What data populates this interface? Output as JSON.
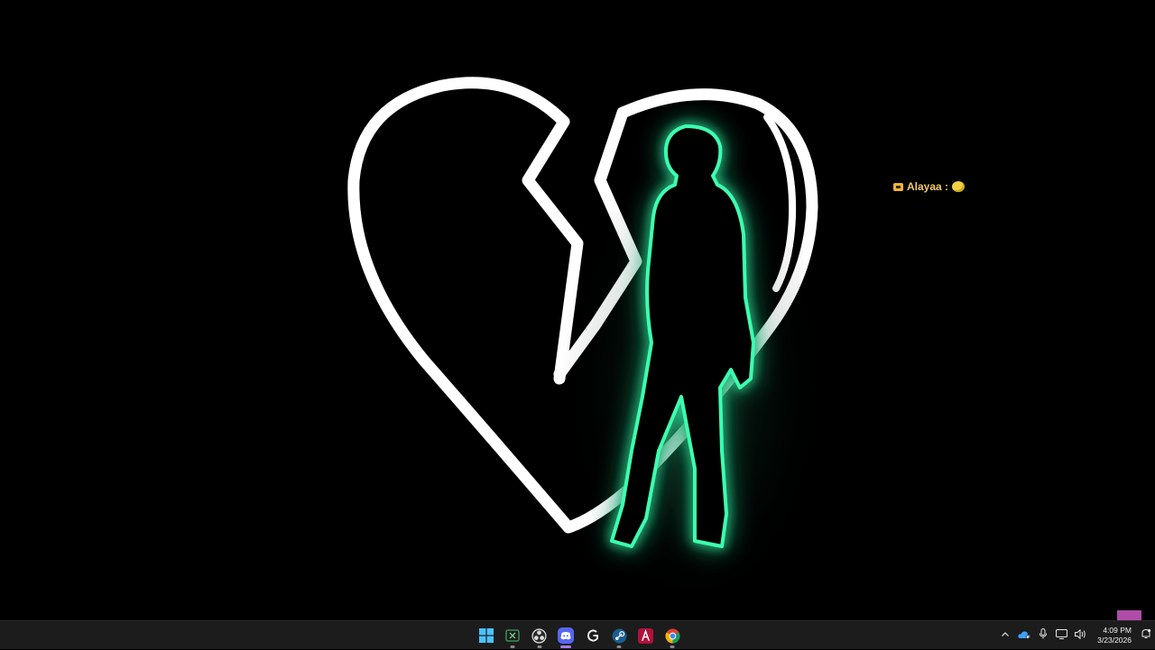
{
  "desktop": {
    "overlay_username": "Alayaa :",
    "colors": {
      "background": "#000000",
      "heart_outline": "#ffffff",
      "figure_glow": "#3dffb0",
      "overlay_text": "#f2c66a",
      "magenta_block": "#b04ca8"
    }
  },
  "taskbar": {
    "apps": [
      {
        "name": "start",
        "icon": "windows-start-icon",
        "running": false,
        "active": false
      },
      {
        "name": "xbox",
        "icon": "xbox-app-icon",
        "running": true,
        "active": false
      },
      {
        "name": "obs",
        "icon": "obs-studio-icon",
        "running": true,
        "active": false
      },
      {
        "name": "discord",
        "icon": "discord-icon",
        "running": true,
        "active": true
      },
      {
        "name": "g-app",
        "icon": "g-launcher-icon",
        "running": false,
        "active": false
      },
      {
        "name": "steam",
        "icon": "steam-icon",
        "running": true,
        "active": false
      },
      {
        "name": "aura",
        "icon": "red-a-app-icon",
        "running": false,
        "active": false
      },
      {
        "name": "chrome",
        "icon": "chrome-icon",
        "running": true,
        "active": false
      }
    ],
    "tray": {
      "icons": [
        "chevron-up-icon",
        "onedrive-icon",
        "microphone-icon",
        "display-network-icon",
        "volume-icon"
      ],
      "time": "4:09 PM",
      "date": "3/23/2026",
      "notification_icon": "notification-bell-icon"
    }
  }
}
